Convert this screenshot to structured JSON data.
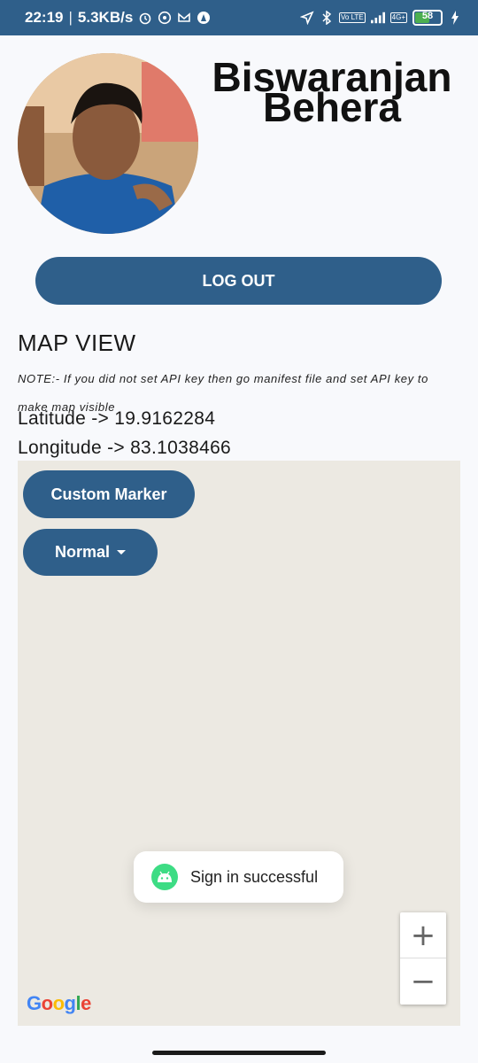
{
  "status_bar": {
    "time": "22:19",
    "separator": "|",
    "speed": "5.3KB/s",
    "battery_level": "58",
    "network_label": "4G+",
    "volte_label": "Vo LTE",
    "icons": [
      "alarm-icon",
      "whatsapp-icon",
      "gmail-icon",
      "app-icon",
      "location-icon",
      "bluetooth-icon",
      "signal-icon",
      "battery-icon",
      "charging-icon"
    ]
  },
  "profile": {
    "name": "Biswaranjan Behera"
  },
  "logout_label": "LOG OUT",
  "map_section": {
    "title": "MAP VIEW",
    "note": "NOTE:- If you did not set API key then go manifest file and set API key to make map visible",
    "latitude": "Latitude -> 19.9162284",
    "longitude": "Longitude -> 83.1038466"
  },
  "map": {
    "custom_marker_label": "Custom Marker",
    "map_type_label": "Normal",
    "zoom_in_label": "+",
    "zoom_out_label": "−",
    "google_letters": [
      "G",
      "o",
      "o",
      "g",
      "l",
      "e"
    ],
    "google_colors": [
      "#4285F4",
      "#EA4335",
      "#FBBC05",
      "#4285F4",
      "#34A853",
      "#EA4335"
    ]
  },
  "toast": {
    "message": "Sign in successful"
  },
  "colors": {
    "primary": "#2f5f8a",
    "background": "#f8f9fc",
    "map_bg": "#ece9e2",
    "android_green": "#3ddc84"
  }
}
